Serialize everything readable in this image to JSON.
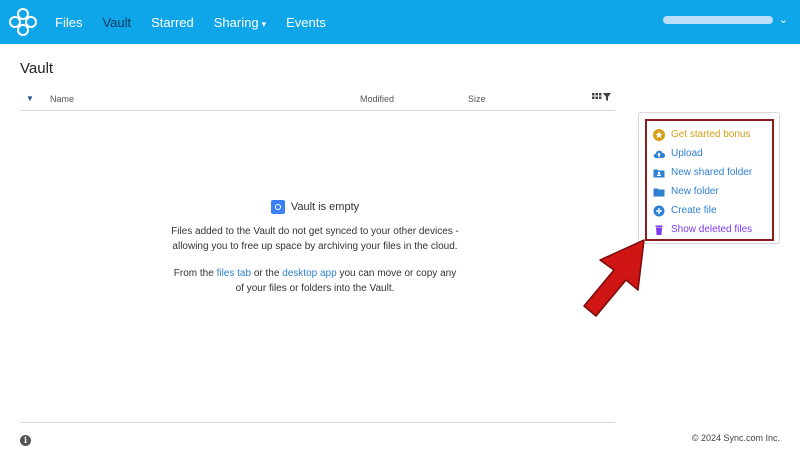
{
  "nav": {
    "items": [
      {
        "label": "Files",
        "active": false
      },
      {
        "label": "Vault",
        "active": true
      },
      {
        "label": "Starred",
        "active": false
      },
      {
        "label": "Sharing",
        "active": false,
        "has_caret": true
      },
      {
        "label": "Events",
        "active": false
      }
    ],
    "caret_glyph": "▾",
    "user_caret_glyph": "⌄"
  },
  "page": {
    "title": "Vault"
  },
  "table": {
    "headers": {
      "name": "Name",
      "modified": "Modified",
      "size": "Size"
    }
  },
  "empty_state": {
    "title": "Vault is empty",
    "line1": "Files added to the Vault do not get synced to your other devices - allowing you to free up space by archiving your files in the cloud.",
    "line2_pre": "From the ",
    "line2_link1": "files tab",
    "line2_mid": " or the ",
    "line2_link2": "desktop app",
    "line2_post": " you can move or copy any of your files or folders into the Vault."
  },
  "actions": [
    {
      "label": "Get started bonus",
      "icon": "star-badge-icon",
      "color": "#d4a017"
    },
    {
      "label": "Upload",
      "icon": "cloud-upload-icon",
      "color": "#2f7fd1"
    },
    {
      "label": "New shared folder",
      "icon": "shared-folder-icon",
      "color": "#2f7fd1"
    },
    {
      "label": "New folder",
      "icon": "folder-icon",
      "color": "#2f7fd1"
    },
    {
      "label": "Create file",
      "icon": "plus-circle-icon",
      "color": "#2f7fd1"
    },
    {
      "label": "Show deleted files",
      "icon": "trash-icon",
      "color": "#7c3aed"
    }
  ],
  "footer": {
    "copyright": "© 2024 Sync.com Inc.",
    "info_glyph": "i"
  },
  "colors": {
    "topbar": "#0ea5e9",
    "link": "#2f7fd1",
    "highlight": "#8b1d1d",
    "arrow": "#d01515"
  }
}
